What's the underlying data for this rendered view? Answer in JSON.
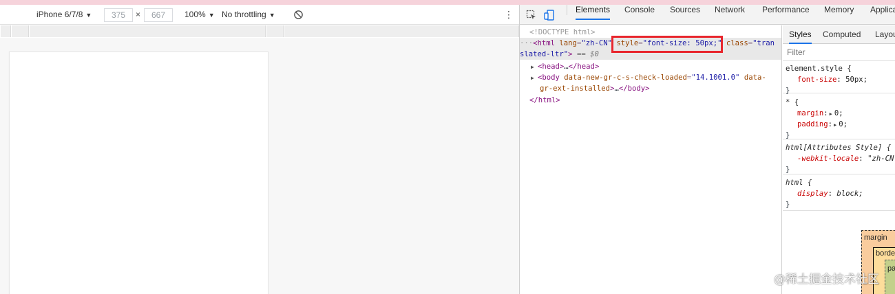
{
  "device_toolbar": {
    "device": "iPhone 6/7/8",
    "width": "375",
    "times": "×",
    "height": "667",
    "zoom": "100%",
    "throttling": "No throttling",
    "more_icon": "⋮"
  },
  "devtools_tabs": [
    "Elements",
    "Console",
    "Sources",
    "Network",
    "Performance",
    "Memory",
    "Applica"
  ],
  "elements_tree": {
    "doctype": "<!DOCTYPE html>",
    "html_open": {
      "prefix": "···",
      "tag_open": "<html",
      "attr1_name": "lang",
      "attr1_value": "\"zh-CN\"",
      "attr2_name": "style",
      "attr2_value": "\"font-size: 50px;",
      "attr2_quote_end": "\"",
      "attr3_name": "class",
      "attr3_value_a": "\"tran",
      "attr3_value_b": "slated-ltr\"",
      "tag_close": ">",
      "eq": " == ",
      "dollar": "$0"
    },
    "head": {
      "open": "<head>",
      "ellipsis": "…",
      "close": "</head>"
    },
    "body": {
      "open": "<body",
      "attr1_name": "data-new-gr-c-s-check-loaded",
      "attr1_value": "\"14.1001.0\"",
      "attr2_name_a": "data-",
      "attr2_name_b": "gr-ext-installed",
      "close_tag": ">",
      "ellipsis": "…",
      "end": "</body>"
    },
    "html_close": "</html>"
  },
  "styles_panel": {
    "tabs": [
      "Styles",
      "Computed",
      "Layou"
    ],
    "filter_placeholder": "Filter",
    "rules": {
      "element_style": {
        "selector": "element.style {",
        "prop": "font-size",
        "value": "50px;",
        "close": "}"
      },
      "universal": {
        "selector": "* {",
        "props": [
          {
            "prop": "margin",
            "value": "0;"
          },
          {
            "prop": "padding",
            "value": "0;"
          }
        ],
        "close": "}"
      },
      "html_attr": {
        "selector": "html[Attributes Style] {",
        "prop": "-webkit-locale",
        "value": "\"zh-CN",
        "close": "}"
      },
      "html": {
        "selector": "html {",
        "prop": "display",
        "value": "block;",
        "close": "}"
      }
    },
    "box_model": {
      "margin": "margin",
      "border": "borde",
      "padding": "pa",
      "dash1": "–",
      "dash2": "–"
    }
  },
  "watermark": "@稀土掘金技术社区",
  "colors": {
    "highlight_box": "#e8262d",
    "active_tab": "#1a73e8"
  }
}
